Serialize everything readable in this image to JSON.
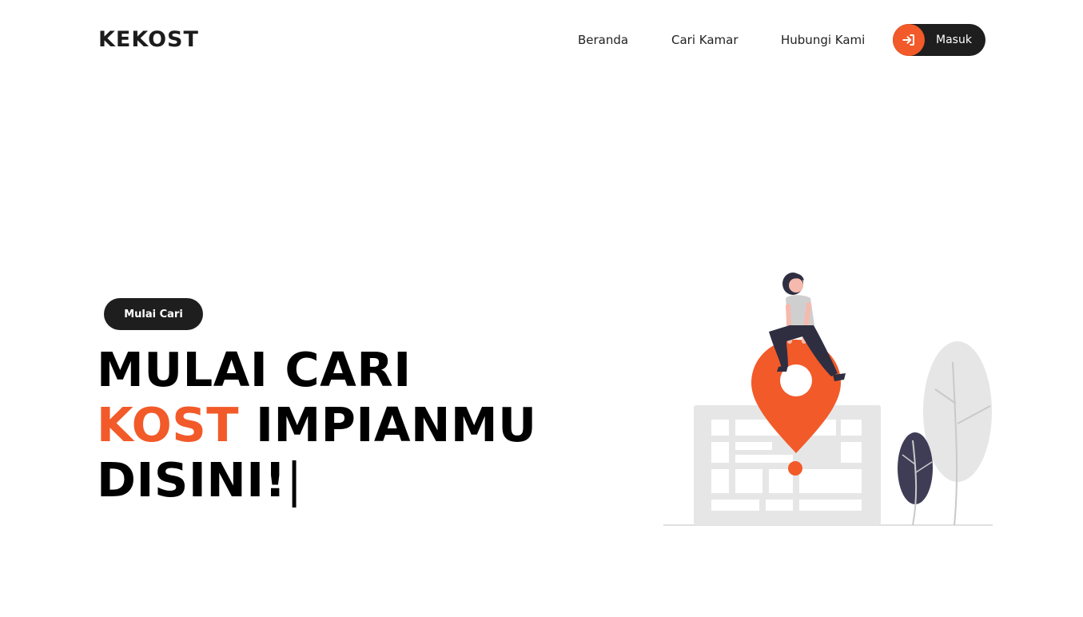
{
  "nav": {
    "brand": "KEKOST",
    "links": [
      "Beranda",
      "Cari Kamar",
      "Hubungi Kami"
    ],
    "login_label": "Masuk"
  },
  "hero": {
    "badge_label": "Mulai Cari",
    "title_line1": "MULAI CARI",
    "title_line2_accent": "KOST",
    "title_line2_rest": " IMPIANMU",
    "title_line3": "DISINI!",
    "cursor_char": "|"
  },
  "colors": {
    "accent": "#f25a29",
    "dark": "#1e1e1e",
    "illustration_gray": "#e6e6e6",
    "leaf_dark": "#3f3d56"
  },
  "icons": {
    "login": "sign-in-icon",
    "illustration": "map-pin-person-illustration"
  }
}
